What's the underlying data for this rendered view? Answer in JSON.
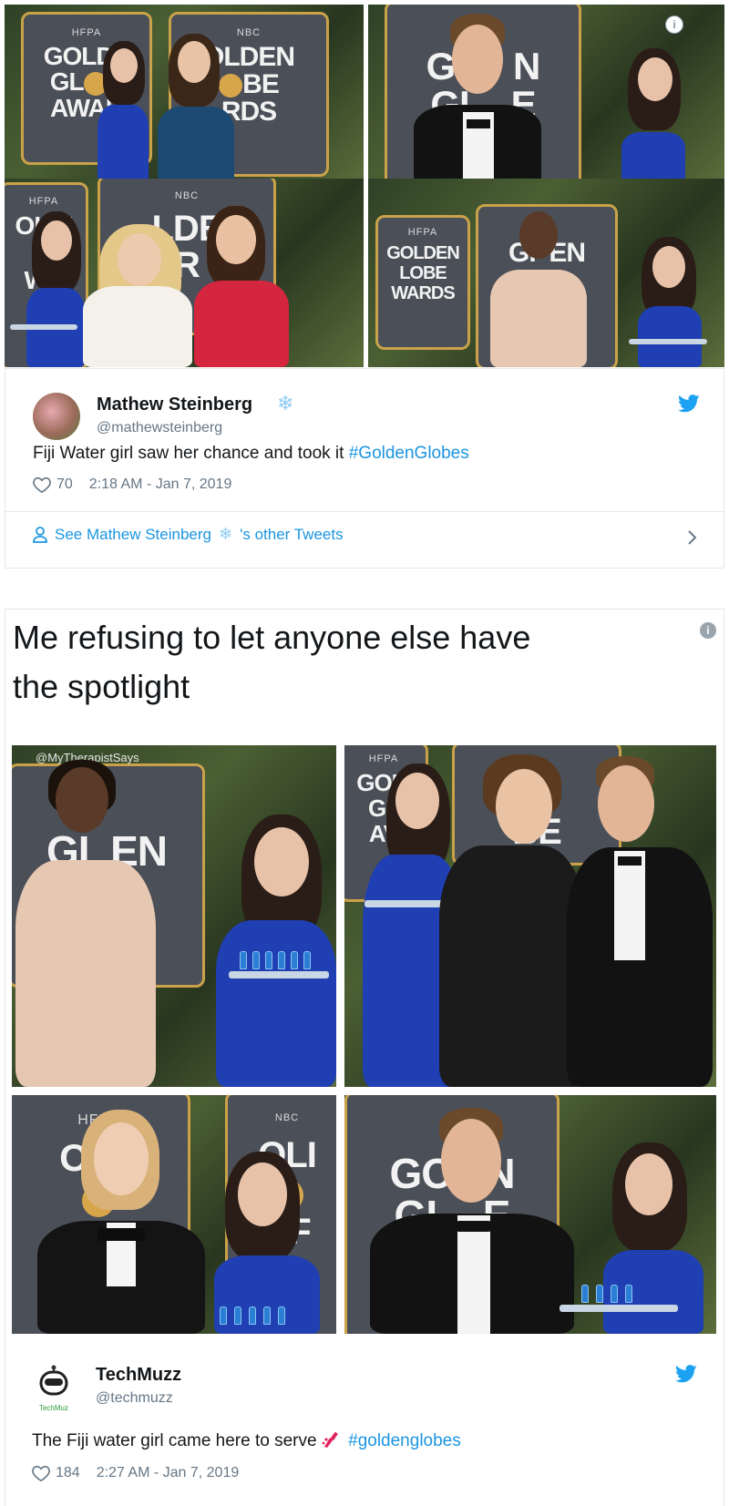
{
  "tweet1": {
    "name": "Mathew Steinberg",
    "name_decoration": "❄",
    "handle": "@mathewsteinberg",
    "text": "Fiji Water girl saw her chance and took it ",
    "hashtag": "#GoldenGlobes",
    "likes": "70",
    "timestamp": "2:18 AM - Jan 7, 2019",
    "other_tweets_prefix": "See Mathew Steinberg",
    "other_tweets_suffix": "'s other Tweets",
    "photo_count": 4
  },
  "tweet2": {
    "caption_line1": "Me refusing to let anyone else have",
    "caption_line2": "the spotlight",
    "watermark": "@MyTherapistSays",
    "name": "TechMuzz",
    "handle": "@techmuzz",
    "avatar_text": "TechMuz",
    "text": "The Fiji water girl came here to serve ",
    "hashtag": "#goldenglobes",
    "likes": "184",
    "timestamp": "2:27 AM - Jan 7, 2019"
  },
  "boards": {
    "hfpa": "HFPA",
    "nbc": "NBC",
    "golden": "GOLDEN",
    "globe": "GLOBE",
    "awards": "AWARDS"
  },
  "icons": {
    "heart": "heart-icon",
    "twitter": "twitter-bird-icon",
    "info": "info-icon",
    "person": "person-icon",
    "chevron": "chevron-right-icon"
  },
  "colors": {
    "link_blue": "#1b95e0",
    "muted": "#657786",
    "twitter_blue": "#1da1f2"
  }
}
